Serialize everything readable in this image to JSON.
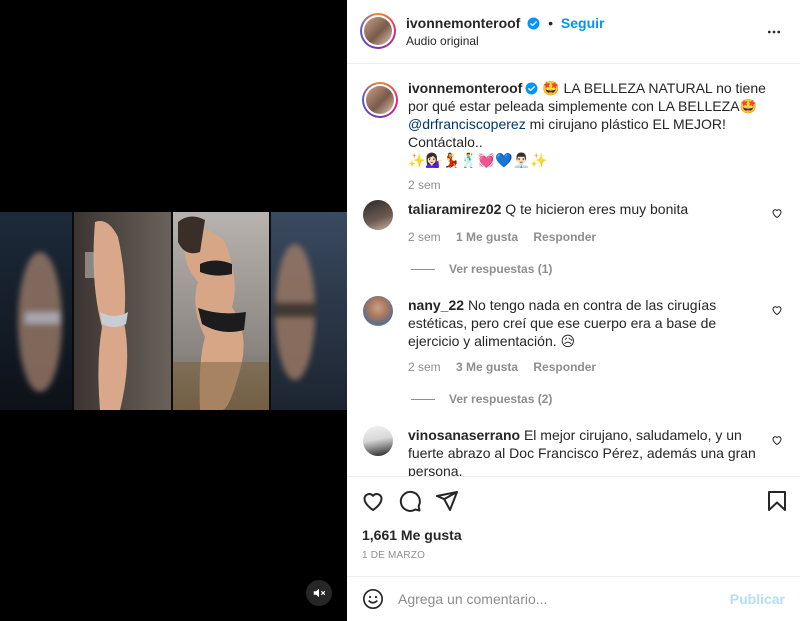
{
  "post": {
    "author": "ivonnemonteroof",
    "verified": true,
    "follow_label": "Seguir",
    "dot": "•",
    "audio_label": "Audio original",
    "more_icon": "more-options-icon",
    "mute_icon": "speaker-muted-icon"
  },
  "caption": {
    "author": "ivonnemonteroof",
    "text_part1": "🤩 LA BELLEZA NATURAL no tiene por qué estar peleada simplemente con LA BELLEZA🤩 ",
    "mention": "@drfranciscoperez",
    "text_part2": " mi cirujano plástico EL MEJOR! Contáctalo..",
    "emoji_line": "✨💁🏻‍♀️💃🕺💓💙👨🏻‍💼✨",
    "time": "2 sem"
  },
  "comments": [
    {
      "user": "taliaramirez02",
      "text": "Q te hicieron eres muy bonita",
      "time": "2 sem",
      "likes": "1 Me gusta",
      "reply_label": "Responder",
      "view_replies": "Ver respuestas (1)"
    },
    {
      "user": "nany_22",
      "text": "No tengo nada en contra de las cirugías estéticas, pero creí que ese cuerpo era a base de ejercicio y alimentación. 😥",
      "time": "2 sem",
      "likes": "3 Me gusta",
      "reply_label": "Responder",
      "view_replies": "Ver respuestas (2)"
    },
    {
      "user": "vinosanaserrano",
      "text": "El mejor cirujano, saludamelo, y un fuerte abrazo al Doc Francisco Pérez, además una gran persona."
    }
  ],
  "actions": {
    "like_icon": "heart-icon",
    "comment_icon": "comment-bubble-icon",
    "share_icon": "paper-plane-icon",
    "save_icon": "bookmark-icon",
    "likes_count": "1,661 Me gusta",
    "date": "1 DE MARZO"
  },
  "composer": {
    "emoji_icon": "emoji-smiley-icon",
    "placeholder": "Agrega un comentario...",
    "publish_label": "Publicar"
  },
  "colors": {
    "link_blue": "#0095f6",
    "mention": "#00376b",
    "muted": "#8e8e8e",
    "publish_disabled": "#b2dffc",
    "verified_badge": "#0095f6"
  }
}
